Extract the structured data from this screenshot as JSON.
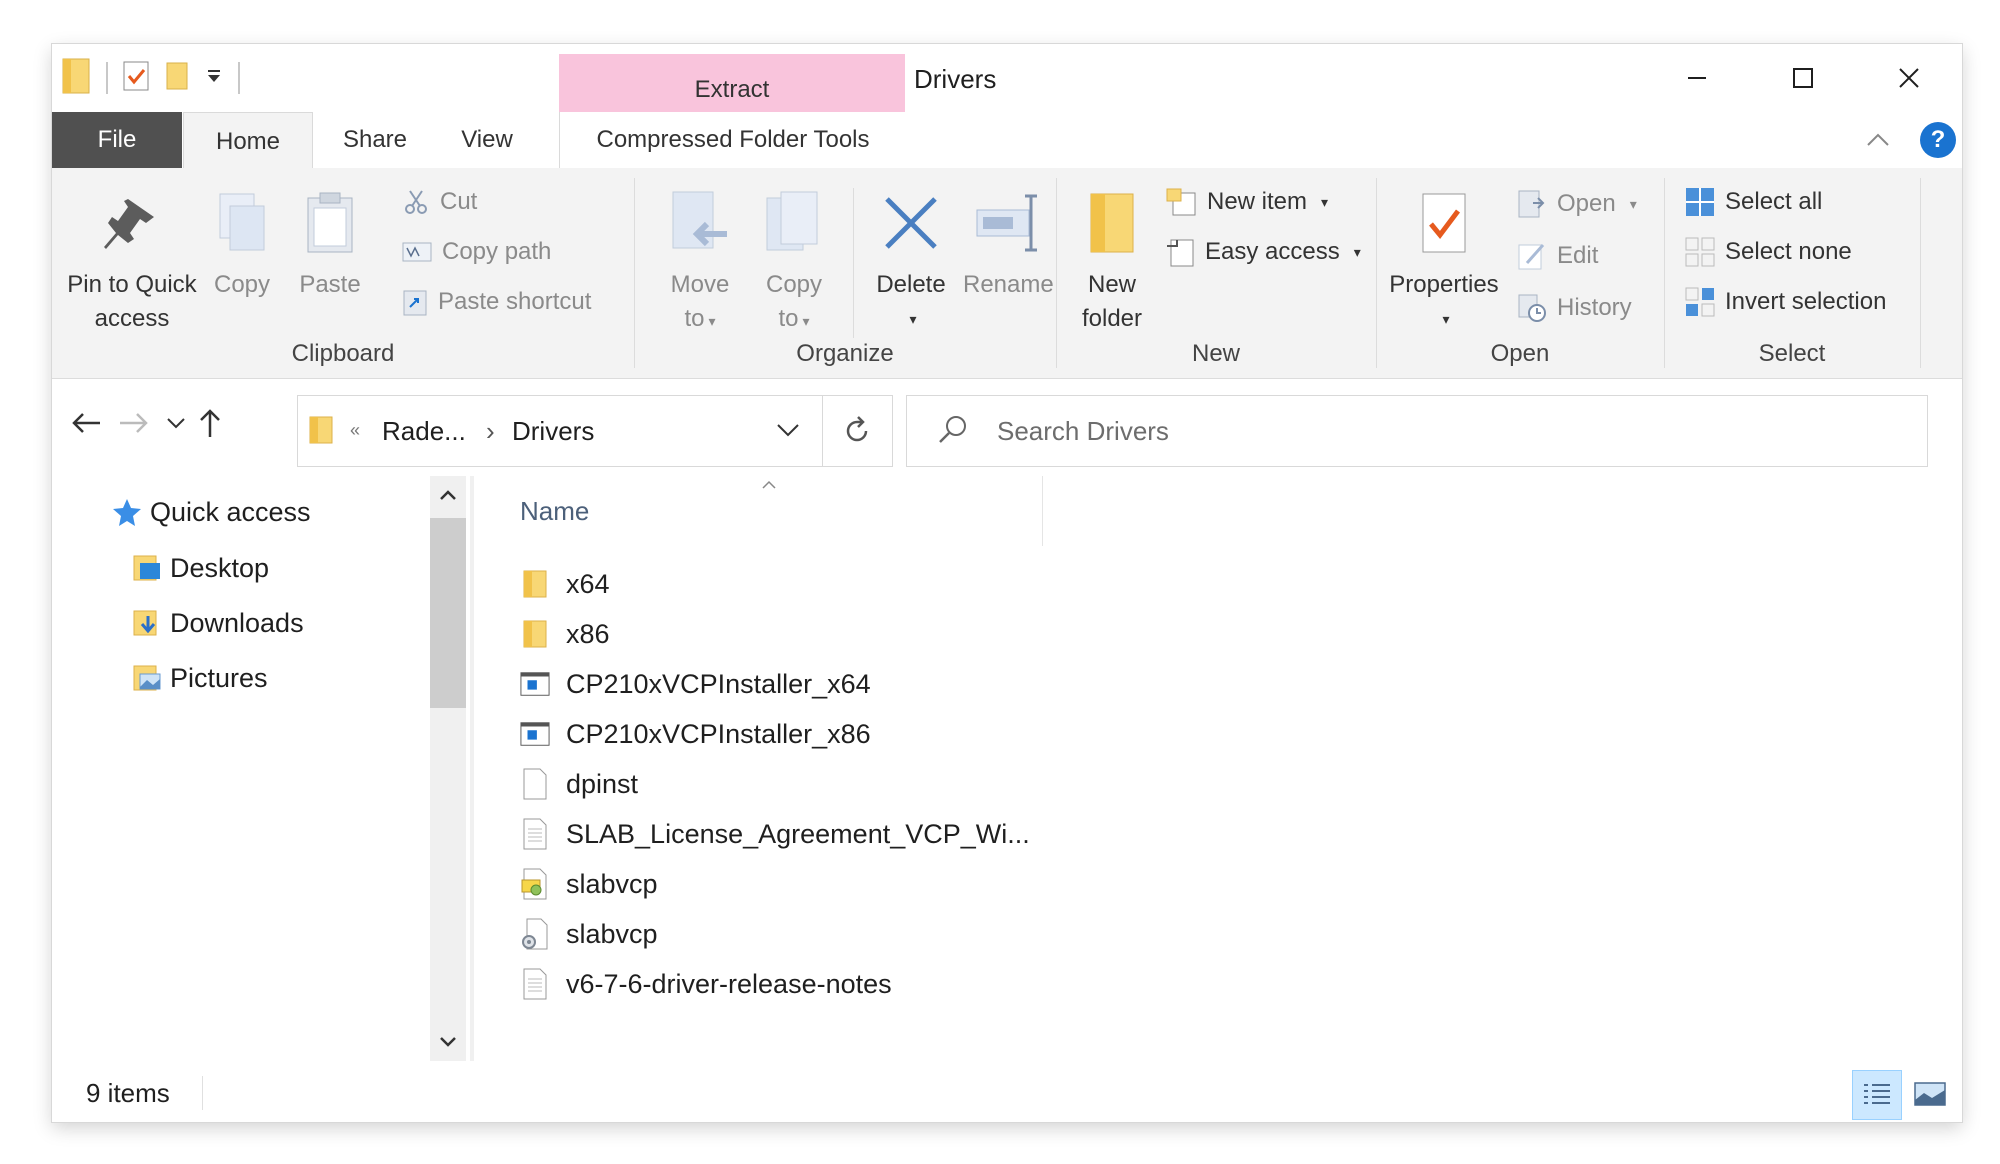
{
  "window": {
    "title": "Drivers",
    "contextual_tab_group": "Extract"
  },
  "ribbon_tabs": {
    "file": "File",
    "home": "Home",
    "share": "Share",
    "view": "View",
    "compressed": "Compressed Folder Tools"
  },
  "ribbon": {
    "clipboard": {
      "label": "Clipboard",
      "pin": [
        "Pin to Quick",
        "access"
      ],
      "copy": "Copy",
      "paste": "Paste",
      "cut": "Cut",
      "copy_path": "Copy path",
      "paste_shortcut": "Paste shortcut"
    },
    "organize": {
      "label": "Organize",
      "move_to": [
        "Move",
        "to"
      ],
      "copy_to": [
        "Copy",
        "to"
      ],
      "delete": "Delete",
      "rename": "Rename"
    },
    "new": {
      "label": "New",
      "new_folder": [
        "New",
        "folder"
      ],
      "new_item": "New item",
      "easy_access": "Easy access"
    },
    "open": {
      "label": "Open",
      "properties": "Properties",
      "open": "Open",
      "edit": "Edit",
      "history": "History"
    },
    "select": {
      "label": "Select",
      "select_all": "Select all",
      "select_none": "Select none",
      "invert": "Invert selection"
    }
  },
  "address": {
    "overflow": "«",
    "parent": "Rade...",
    "current": "Drivers",
    "separator": "›"
  },
  "search": {
    "placeholder": "Search Drivers"
  },
  "nav": {
    "quick_access": "Quick access",
    "items": [
      "Desktop",
      "Downloads",
      "Pictures"
    ]
  },
  "columns": {
    "name": "Name"
  },
  "files": [
    {
      "name": "x64",
      "icon": "folder-icon"
    },
    {
      "name": "x86",
      "icon": "folder-icon"
    },
    {
      "name": "CP210xVCPInstaller_x64",
      "icon": "application-icon"
    },
    {
      "name": "CP210xVCPInstaller_x86",
      "icon": "application-icon"
    },
    {
      "name": "dpinst",
      "icon": "document-icon"
    },
    {
      "name": "SLAB_License_Agreement_VCP_Wi...",
      "icon": "text-file-icon"
    },
    {
      "name": "slabvcp",
      "icon": "security-catalog-icon"
    },
    {
      "name": "slabvcp",
      "icon": "setup-information-icon"
    },
    {
      "name": "v6-7-6-driver-release-notes",
      "icon": "text-file-icon"
    }
  ],
  "status": {
    "items": "9 items"
  },
  "colors": {
    "accent": "#1a73d0",
    "context_tab": "#f9c4dc",
    "file_tab": "#505050",
    "folder": "#f8d775"
  }
}
